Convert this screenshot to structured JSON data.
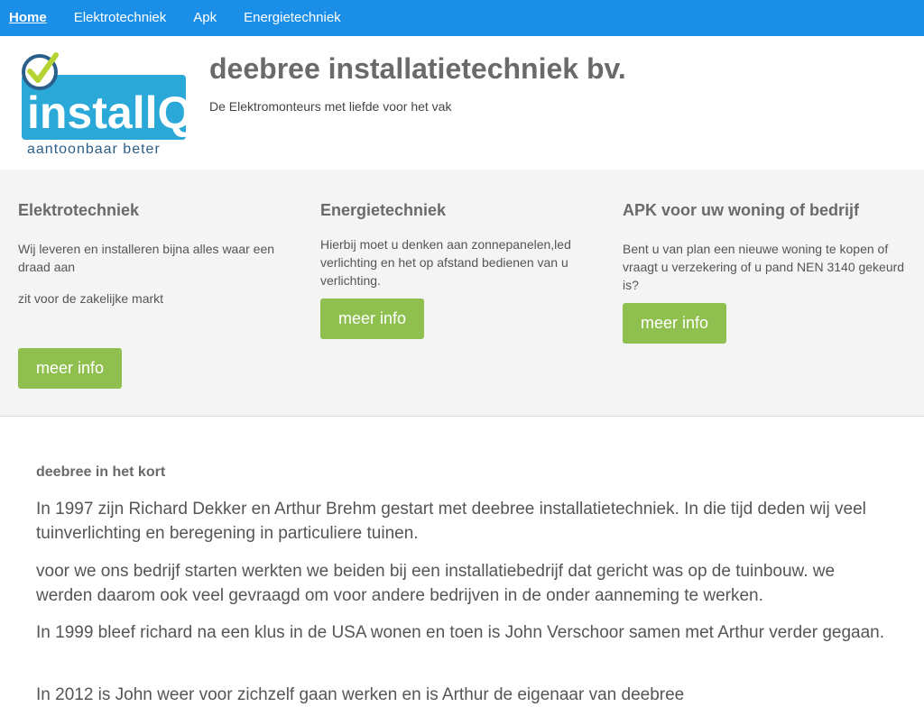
{
  "nav": {
    "items": [
      {
        "label": "Home",
        "active": true
      },
      {
        "label": "Elektrotechniek"
      },
      {
        "label": "Apk"
      },
      {
        "label": "Energietechniek"
      }
    ]
  },
  "header": {
    "logo": {
      "brand": "installQ",
      "tagline": "aantoonbaar beter"
    },
    "title": "deebree installatietechniek bv.",
    "subtitle": "De Elektromonteurs met liefde voor het vak"
  },
  "services": [
    {
      "title": "Elektrotechniek",
      "paragraphs": [
        "Wij leveren en installeren bijna alles waar een draad aan",
        "zit voor de zakelijke markt"
      ],
      "button": "meer info"
    },
    {
      "title": "Energietechniek",
      "paragraphs": [
        "Hierbij moet u denken aan zonnepanelen,led verlichting en het op afstand bedienen van u verlichting."
      ],
      "button": "meer info"
    },
    {
      "title": "APK voor uw woning of bedrijf",
      "paragraphs": [
        "Bent u van plan een nieuwe woning te kopen of vraagt u verzekering of u pand NEN 3140 gekeurd is?"
      ],
      "button": "meer info"
    }
  ],
  "about": {
    "heading": "deebree in het kort",
    "paragraphs": [
      "In 1997 zijn Richard Dekker en Arthur Brehm gestart met deebree installatietechniek. In die tijd deden wij veel tuinverlichting en beregening in particuliere tuinen.",
      "voor we ons bedrijf starten werkten we beiden bij een installatiebedrijf dat gericht was op de tuinbouw. we werden daarom ook veel gevraagd om voor andere bedrijven in de onder aanneming te werken.",
      "In 1999 bleef richard na een klus in de USA wonen en toen is John Verschoor samen met Arthur verder gegaan.",
      "In 2012 is John weer voor zichzelf gaan werken en is Arthur de eigenaar van deebree"
    ]
  },
  "colors": {
    "nav_bg": "#1b8fe8",
    "button_bg": "#8fbf4f",
    "logo_blue": "#2aa8d8",
    "logo_check_green": "#b6d334",
    "services_bg": "#f4f4f4"
  }
}
